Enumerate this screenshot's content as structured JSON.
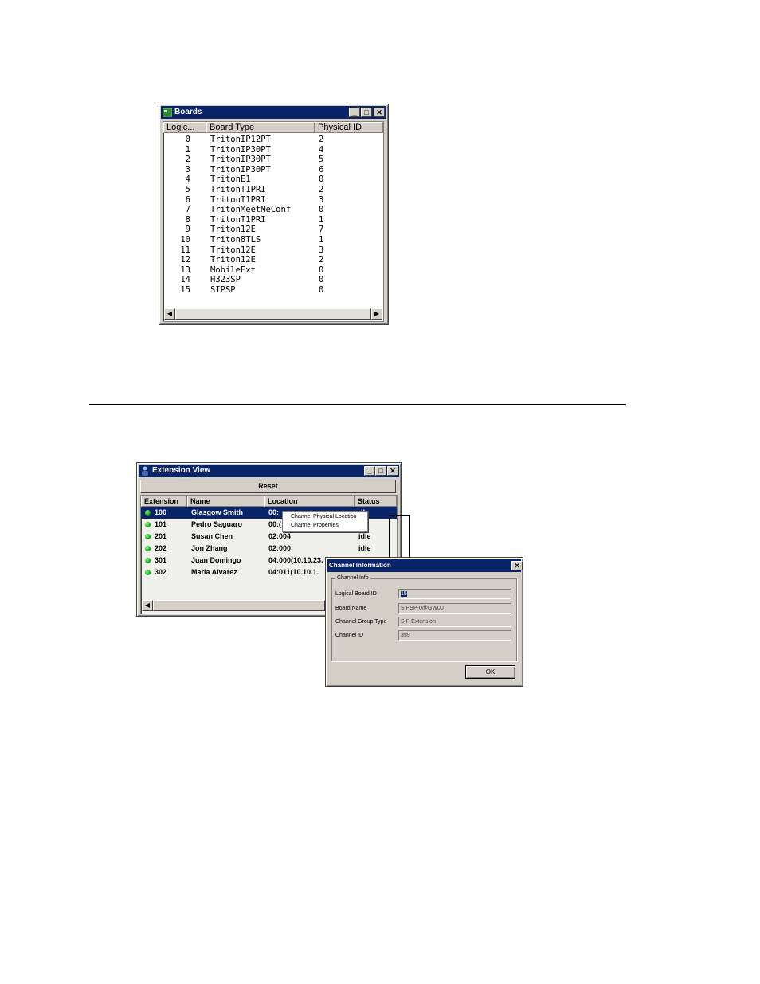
{
  "boards_window": {
    "title": "Boards",
    "columns": [
      "Logic...",
      "Board Type",
      "Physical ID"
    ],
    "rows": [
      {
        "logical": "0",
        "type": "TritonIP12PT",
        "physical": "2"
      },
      {
        "logical": "1",
        "type": "TritonIP30PT",
        "physical": "4"
      },
      {
        "logical": "2",
        "type": "TritonIP30PT",
        "physical": "5"
      },
      {
        "logical": "3",
        "type": "TritonIP30PT",
        "physical": "6"
      },
      {
        "logical": "4",
        "type": "TritonE1",
        "physical": "0"
      },
      {
        "logical": "5",
        "type": "TritonT1PRI",
        "physical": "2"
      },
      {
        "logical": "6",
        "type": "TritonT1PRI",
        "physical": "3"
      },
      {
        "logical": "7",
        "type": "TritonMeetMeConf",
        "physical": "0"
      },
      {
        "logical": "8",
        "type": "TritonT1PRI",
        "physical": "1"
      },
      {
        "logical": "9",
        "type": "Triton12E",
        "physical": "7"
      },
      {
        "logical": "10",
        "type": "Triton8TLS",
        "physical": "1"
      },
      {
        "logical": "11",
        "type": "Triton12E",
        "physical": "3"
      },
      {
        "logical": "12",
        "type": "Triton12E",
        "physical": "2"
      },
      {
        "logical": "13",
        "type": "MobileExt",
        "physical": "0"
      },
      {
        "logical": "14",
        "type": "H323SP",
        "physical": "0"
      },
      {
        "logical": "15",
        "type": "SIPSP",
        "physical": "0"
      }
    ]
  },
  "extension_window": {
    "title": "Extension View",
    "reset_label": "Reset",
    "columns": [
      "Extension",
      "Name",
      "Location",
      "Status"
    ],
    "rows": [
      {
        "ext": "100",
        "name": "Glasgow Smith",
        "location": "00:",
        "status": "dle"
      },
      {
        "ext": "101",
        "name": "Pedro Saguaro",
        "location": "00:(",
        "status": "e"
      },
      {
        "ext": "201",
        "name": "Susan Chen",
        "location": "02:004",
        "status": "idle"
      },
      {
        "ext": "202",
        "name": "Jon Zhang",
        "location": "02:000",
        "status": "idle"
      },
      {
        "ext": "301",
        "name": "Juan Domingo",
        "location": "04:000(10.10.23.",
        "status": "idle"
      },
      {
        "ext": "302",
        "name": "Maria Alvarez",
        "location": "04:011(10.10.1.",
        "status": ""
      }
    ],
    "context_menu": [
      "Channel Physical Location",
      "Channel Properties"
    ]
  },
  "channel_dialog": {
    "title": "Channel Information",
    "group_label": "Channel Info",
    "fields": [
      {
        "label": "Logical Board ID",
        "value": "15"
      },
      {
        "label": "Board Name",
        "value": "SIPSP-0@GW00"
      },
      {
        "label": "Channel Group Type",
        "value": "SIP Extension"
      },
      {
        "label": "Channel ID",
        "value": "399"
      }
    ],
    "ok_label": "OK"
  },
  "colors": {
    "titlebar": "#0a246a",
    "window": "#d4d0c8",
    "selection": "#0a246a",
    "status_dot": "#22bb22"
  }
}
